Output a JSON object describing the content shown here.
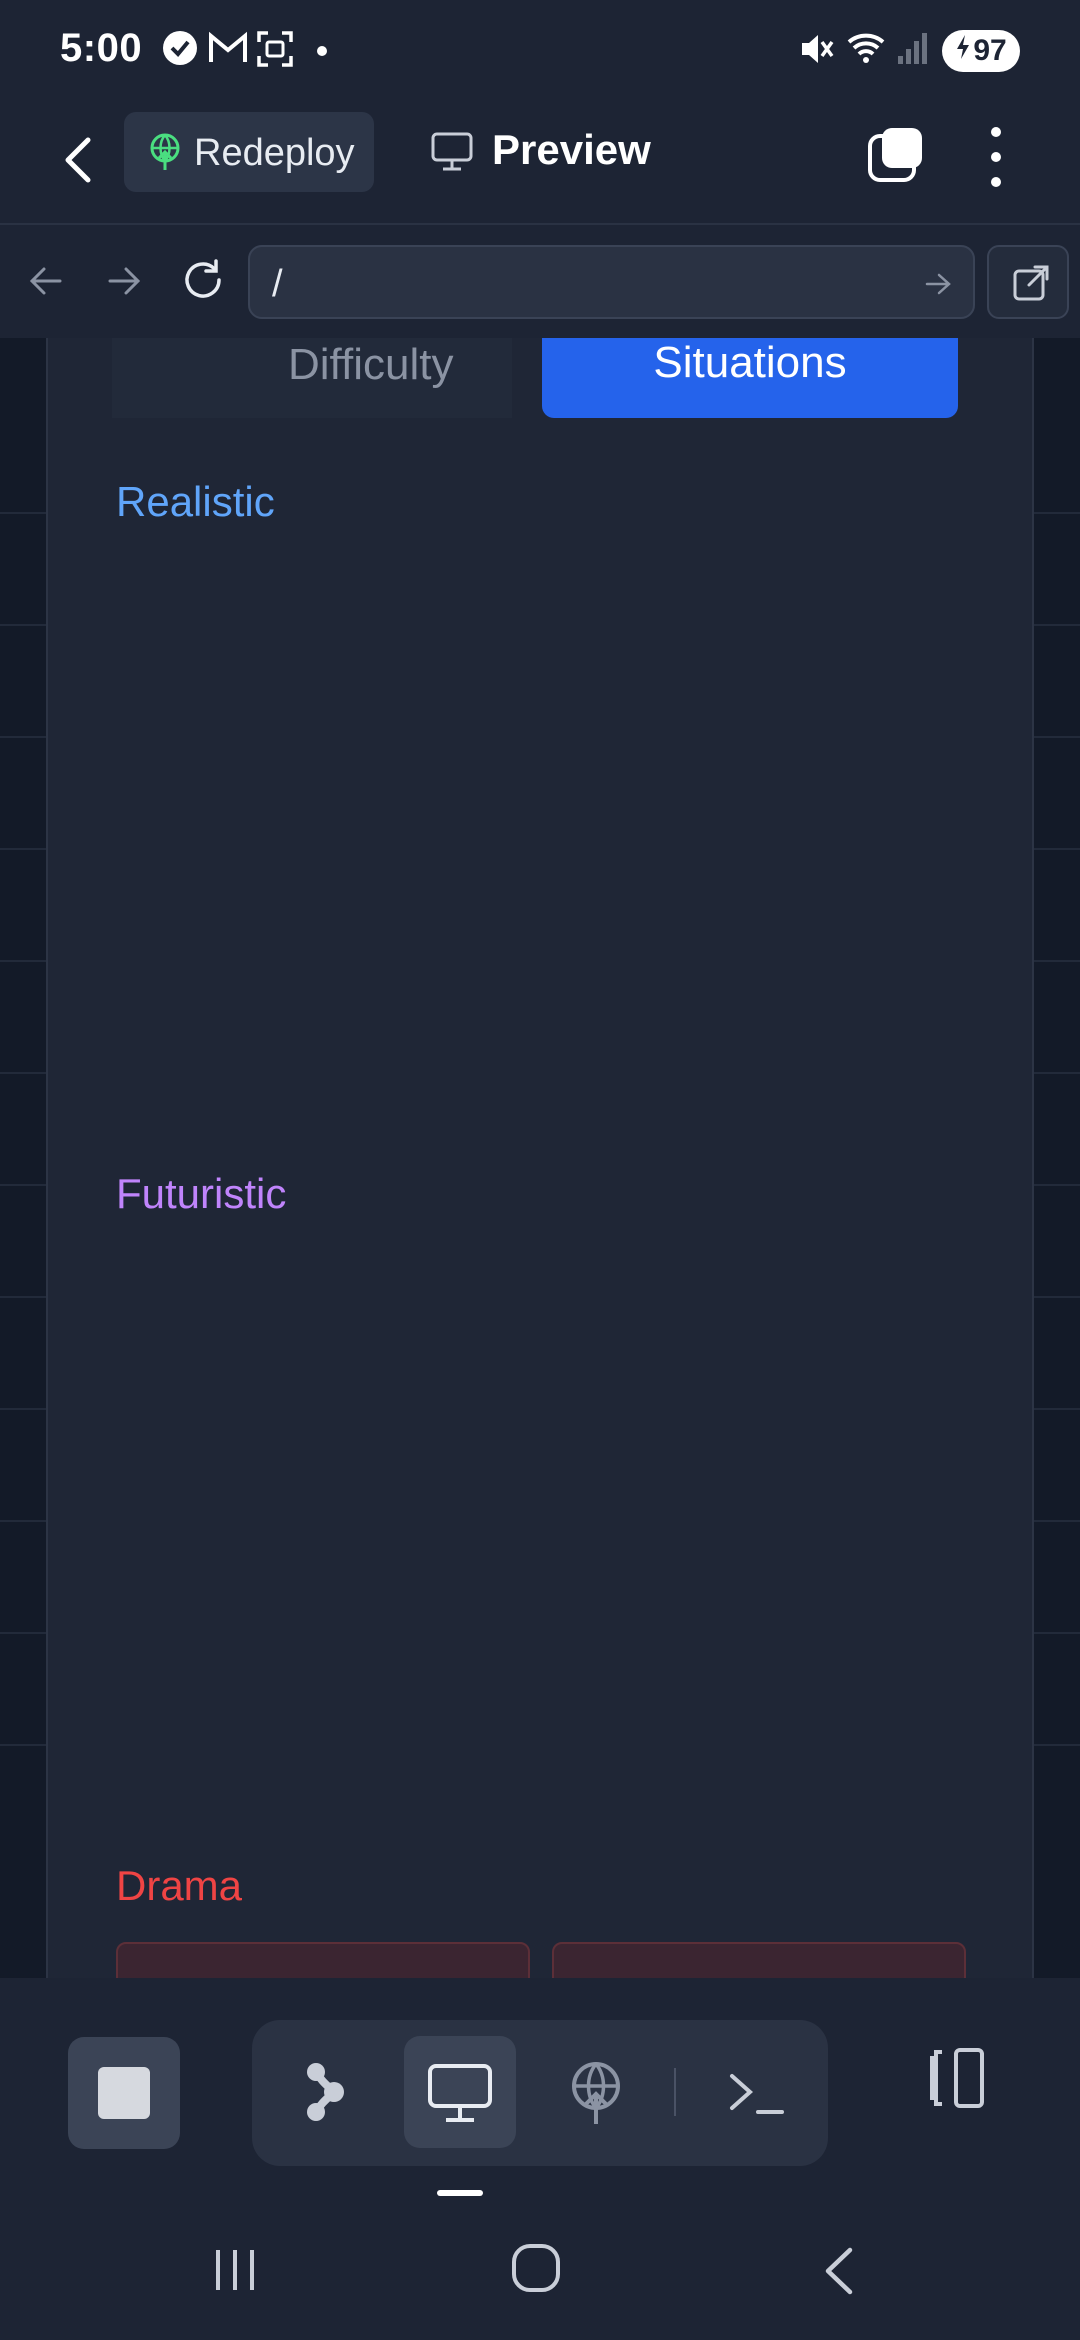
{
  "status_bar": {
    "time": "5:00",
    "battery": "97",
    "icons": [
      "check-circle-icon",
      "gmail-icon",
      "screenshot-icon",
      "dot-icon",
      "mute-icon",
      "wifi-icon",
      "signal-icon",
      "charging-icon"
    ]
  },
  "app_bar": {
    "redeploy_label": "Redeploy",
    "preview_label": "Preview"
  },
  "url_bar": {
    "url": "/"
  },
  "page": {
    "tabs": {
      "difficulty": "Difficulty",
      "situations": "Situations"
    },
    "sections": {
      "realistic": "Realistic",
      "futuristic": "Futuristic",
      "drama": "Drama"
    },
    "colors": {
      "realistic": "#60a5fa",
      "futuristic": "#c084fc",
      "drama": "#ef4444",
      "active_tab": "#2563eb"
    }
  },
  "toolbar": {
    "icons": [
      "stop-icon",
      "git-branch-icon",
      "monitor-icon",
      "deploy-globe-icon",
      "terminal-icon",
      "split-view-icon"
    ]
  }
}
